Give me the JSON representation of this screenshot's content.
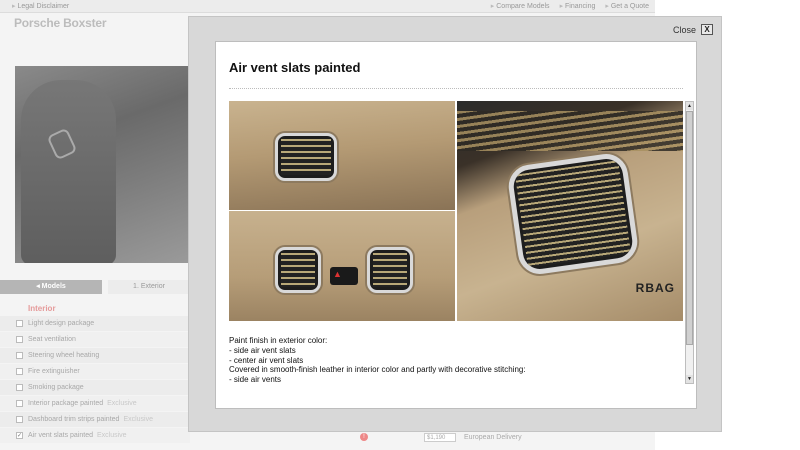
{
  "background": {
    "top_links": {
      "legal": "Legal Disclaimer",
      "right": [
        "Compare Models",
        "Financing",
        "Get a Quote"
      ]
    },
    "page_title": "Porsche Boxster",
    "tabs": [
      "Models",
      "1. Exterior"
    ],
    "section_title": "Interior",
    "options": [
      {
        "label": "Light design package",
        "exclusive": "",
        "checked": false
      },
      {
        "label": "Seat ventilation",
        "exclusive": "",
        "checked": false
      },
      {
        "label": "Steering wheel heating",
        "exclusive": "",
        "checked": false
      },
      {
        "label": "Fire extinguisher",
        "exclusive": "",
        "checked": false
      },
      {
        "label": "Smoking package",
        "exclusive": "",
        "checked": false
      },
      {
        "label": "Interior package painted",
        "exclusive": "Exclusive",
        "checked": false
      },
      {
        "label": "Dashboard trim strips painted",
        "exclusive": "Exclusive",
        "checked": false
      },
      {
        "label": "Air vent slats painted",
        "exclusive": "Exclusive",
        "checked": true
      }
    ],
    "footer": {
      "info_icon": "!",
      "price": "$1,190",
      "delivery": "European Delivery"
    }
  },
  "modal": {
    "close_label": "Close",
    "close_icon": "X",
    "title": "Air vent slats painted",
    "photo_label": "RBAG",
    "description": [
      "Paint finish in exterior color:",
      "- side air vent slats",
      "- center air vent slats",
      "Covered in smooth-finish leather in interior color and partly with decorative stitching:",
      "- side air vents"
    ]
  }
}
